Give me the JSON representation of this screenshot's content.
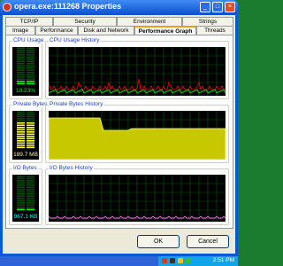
{
  "window": {
    "title": "opera.exe:111268 Properties"
  },
  "tabs_row1": [
    "TCP/IP",
    "Security",
    "Environment",
    "Strings"
  ],
  "tabs_row2": [
    "Image",
    "Performance",
    "Disk and Network",
    "Performance Graph",
    "Threads"
  ],
  "active_tab": "Performance Graph",
  "groups": {
    "cpu_usage": {
      "label": "CPU Usage",
      "value": "10.23%"
    },
    "cpu_history": {
      "label": "CPU Usage History"
    },
    "private_bytes": {
      "label": "Private Bytes",
      "value": "189.7 MB"
    },
    "private_history": {
      "label": "Private Bytes History"
    },
    "io_bytes": {
      "label": "I/O Bytes",
      "value": "967.1  KB"
    },
    "io_history": {
      "label": "I/O Bytes History"
    }
  },
  "buttons": {
    "ok": "OK",
    "cancel": "Cancel"
  },
  "taskbar": {
    "clock": "2:51 PM"
  },
  "colors": {
    "grid": "#0d5a0d",
    "meter_on": "#00ff00",
    "fill_yellow": "#c8c800",
    "cpu_red": "#ff0000",
    "io_pink": "#ff66ff"
  }
}
